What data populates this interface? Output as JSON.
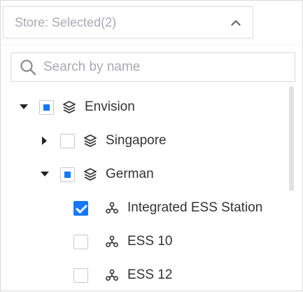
{
  "select": {
    "label": "Store: Selected(2)"
  },
  "search": {
    "placeholder": "Search by name",
    "value": ""
  },
  "colors": {
    "accent": "#1677ff",
    "text": "#333333",
    "placeholder": "#a9a9b3"
  },
  "tree": [
    {
      "label": "Envision",
      "level": 0,
      "expanded": true,
      "check": "indeterminate",
      "icon": "layers-icon"
    },
    {
      "label": "Singapore",
      "level": 1,
      "expanded": false,
      "check": "unchecked",
      "icon": "layers-icon"
    },
    {
      "label": "German",
      "level": 1,
      "expanded": true,
      "check": "indeterminate",
      "icon": "layers-icon"
    },
    {
      "label": "Integrated ESS Station",
      "level": 2,
      "leaf": true,
      "check": "checked",
      "icon": "station-icon"
    },
    {
      "label": "ESS 10",
      "level": 2,
      "leaf": true,
      "check": "unchecked",
      "icon": "station-icon"
    },
    {
      "label": "ESS 12",
      "level": 2,
      "leaf": true,
      "check": "unchecked",
      "icon": "station-icon"
    }
  ]
}
